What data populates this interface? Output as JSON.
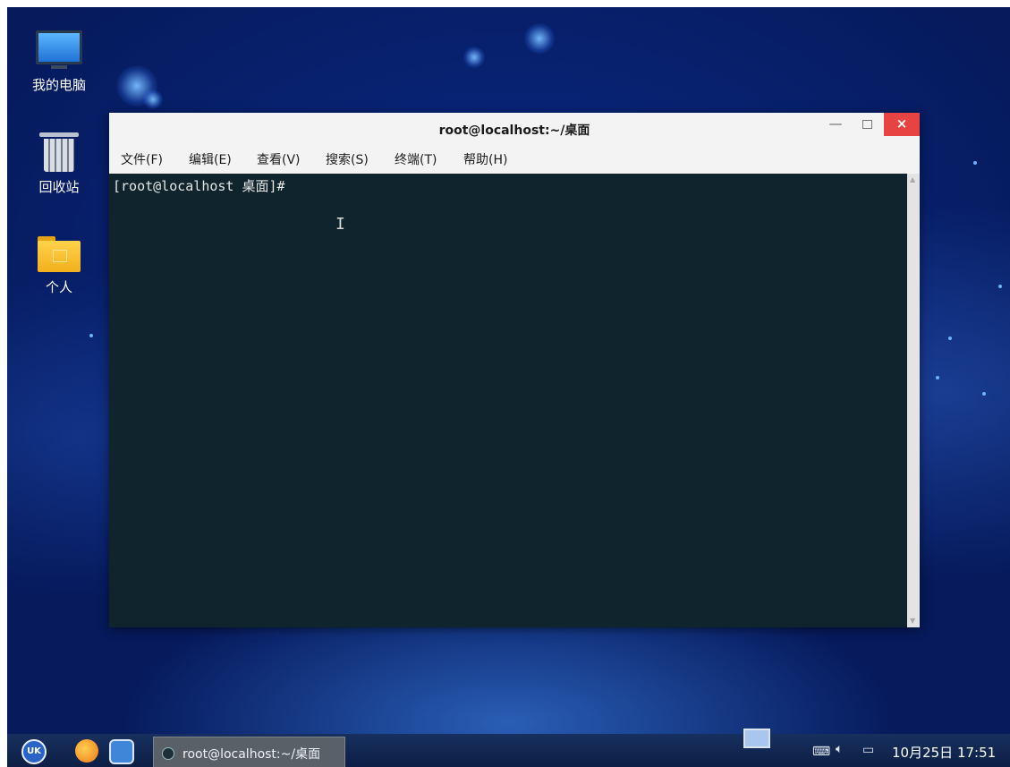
{
  "desktop": {
    "icons": [
      {
        "label": "我的电脑",
        "icon": "computer-icon"
      },
      {
        "label": "回收站",
        "icon": "trash-icon"
      },
      {
        "label": "个人",
        "icon": "home-folder-icon"
      }
    ]
  },
  "window": {
    "title": "root@localhost:~/桌面",
    "controls": {
      "minimize": "—",
      "maximize": "□",
      "close": "×"
    },
    "menu": [
      "文件(F)",
      "编辑(E)",
      "查看(V)",
      "搜索(S)",
      "终端(T)",
      "帮助(H)"
    ],
    "terminal": {
      "prompt": "[root@localhost 桌面]#",
      "cursor": "I"
    }
  },
  "taskbar": {
    "start_label": "UK",
    "task_label": "root@localhost:~/桌面",
    "clock": "10月25日 17:51",
    "tray_icons": [
      "keyboard-icon",
      "volume-icon",
      "network-icon"
    ]
  },
  "colors": {
    "terminal_bg": "#0f242d",
    "close_button": "#e74343",
    "taskbar": "#17305f"
  }
}
